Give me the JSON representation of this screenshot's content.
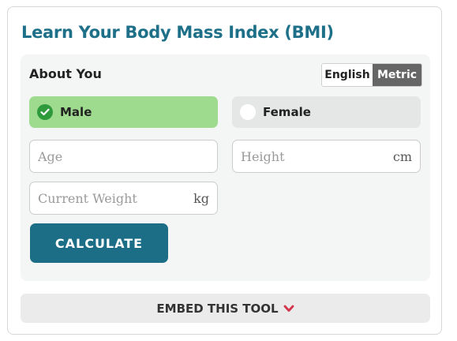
{
  "title": "Learn Your Body Mass Index (BMI)",
  "section_label": "About You",
  "unit_toggle": {
    "english_label": "English",
    "metric_label": "Metric",
    "selected": "Metric"
  },
  "gender": {
    "male_label": "Male",
    "female_label": "Female",
    "selected": "Male"
  },
  "fields": {
    "age": {
      "placeholder": "Age",
      "value": ""
    },
    "height": {
      "placeholder": "Height",
      "unit": "cm",
      "value": ""
    },
    "weight": {
      "placeholder": "Current Weight",
      "unit": "kg",
      "value": ""
    }
  },
  "calculate_label": "CALCULATE",
  "embed_label": "EMBED THIS TOOL",
  "colors": {
    "title": "#1e7089",
    "selected_gender": "#9fdb8f",
    "check": "#2e9a3b",
    "button": "#1b6e86",
    "chevron": "#d2344b"
  }
}
